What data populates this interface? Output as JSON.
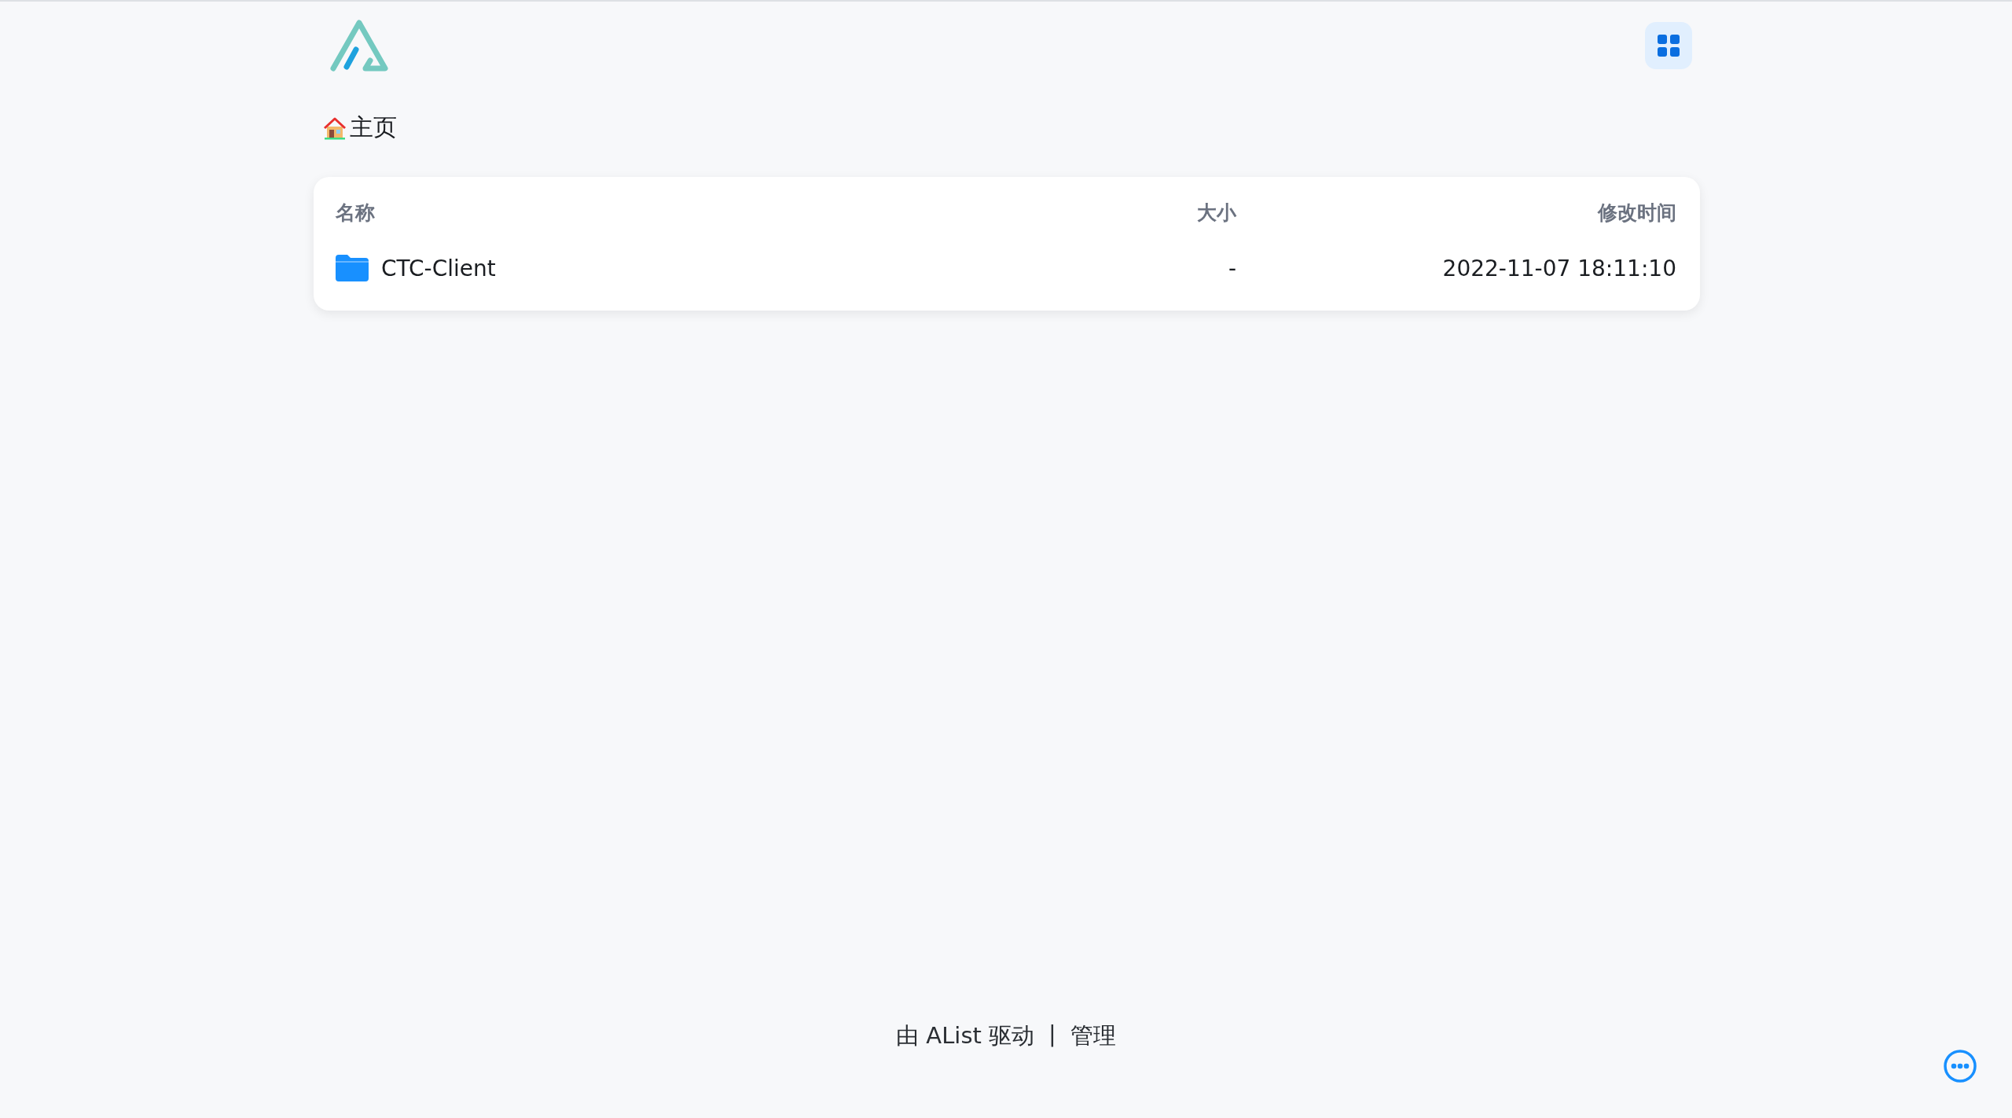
{
  "breadcrumb": {
    "label": "主页"
  },
  "table": {
    "columns": [
      "名称",
      "大小",
      "修改时间"
    ],
    "rows": [
      {
        "kind": "folder",
        "name": "CTC-Client",
        "size": "-",
        "modified": "2022-11-07 18:11:10"
      }
    ]
  },
  "footer": {
    "powered_by": "由 AList 驱动",
    "separator": "|",
    "manage": "管理"
  }
}
